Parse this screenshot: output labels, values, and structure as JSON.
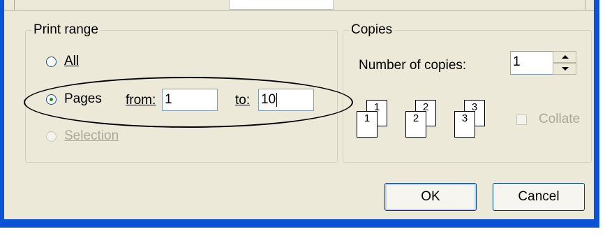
{
  "print_range": {
    "title": "Print range",
    "all_label": "All",
    "pages_label": "Pages",
    "from_label": "from:",
    "from_value": "1",
    "to_label": "to:",
    "to_value": "10",
    "selection_label": "Selection",
    "selected_option": "Pages"
  },
  "copies": {
    "title": "Copies",
    "number_label": "Number of copies:",
    "number_value": "1",
    "collate_label": "Collate",
    "collate_checked": false,
    "collate_enabled": false,
    "stack1": {
      "front": "1",
      "back": "1"
    },
    "stack2": {
      "front": "2",
      "back": "2"
    },
    "stack3": {
      "front": "3",
      "back": "3"
    }
  },
  "buttons": {
    "ok": "OK",
    "cancel": "Cancel"
  },
  "colors": {
    "dialog_bg": "#ece9d8",
    "frame_blue": "#0a53d6",
    "disabled_text": "#aca899"
  }
}
